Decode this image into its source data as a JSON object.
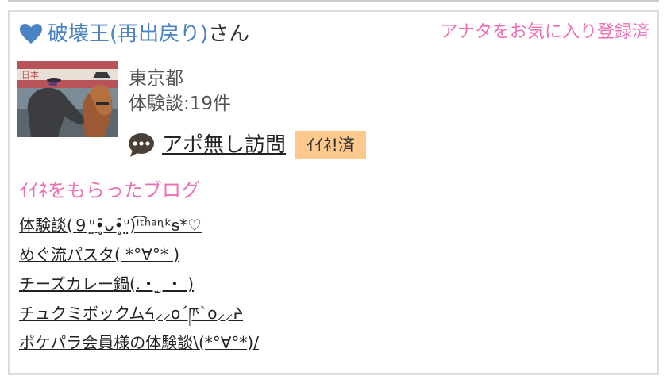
{
  "header": {
    "user_name": "破壊王(再出戻り)",
    "honorific": "さん",
    "favorite_status": "アナタをお気に入り登録済"
  },
  "profile": {
    "location": "東京都",
    "review_count": "体験談:19件"
  },
  "shop": {
    "name": "アポ無し訪問",
    "like_badge": "ｲｲﾈ!済"
  },
  "blogs": {
    "section_title": "ｲｲﾈをもらったブログ",
    "items": [
      "体験談(９ᐡ̤•̥̑ᴗ•̥̑ᐡ̤)ꜝ͡ᵗʰᵃᶯᵏᵴ*♡",
      "めぐ流パスタ( *°∀°* )",
      "チーズカレー鍋(.・ ̫ ・ )",
      "チュクミボックムᔦ⸝⸝o´ཫ`o⸝⸝ᔨ",
      "ポケパラ会員様の体験談\\(*°∀°*)/"
    ]
  },
  "icons": {
    "heart": "heart-icon",
    "chat": "chat-bubble-icon"
  },
  "colors": {
    "user_link": "#4a84c4",
    "accent_pink": "#ee6fb5",
    "badge_bg": "#fdc98c"
  }
}
